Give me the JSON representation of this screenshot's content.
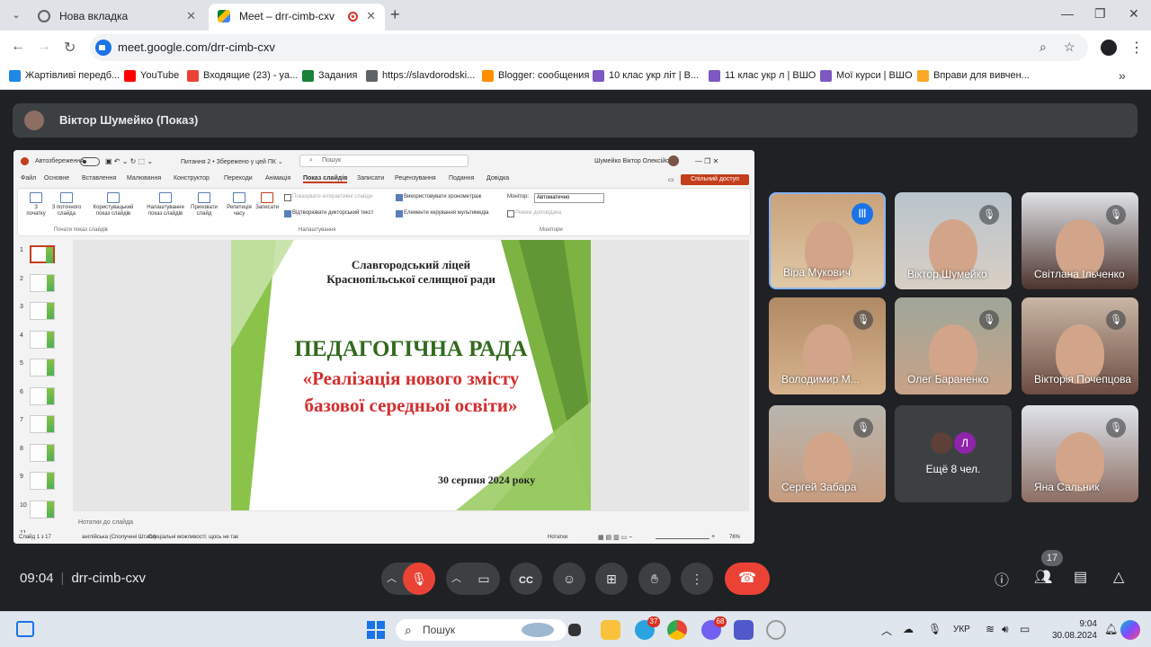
{
  "browser": {
    "tabs": [
      {
        "title": "Нова вкладка"
      },
      {
        "title": "Meet – drr-cimb-cxv"
      }
    ],
    "url": "meet.google.com/drr-cimb-cxv",
    "bookmarks": [
      {
        "label": "Жартівливі передб...",
        "color": "#1e88e5"
      },
      {
        "label": "YouTube",
        "color": "#ff0000"
      },
      {
        "label": "Входящие (23) - ya...",
        "color": "#ea4335"
      },
      {
        "label": "Задания",
        "color": "#188038"
      },
      {
        "label": "https://slavdorodski...",
        "color": "#5f6368"
      },
      {
        "label": "Blogger: сообщения",
        "color": "#ff8f00"
      },
      {
        "label": "10 клас укр літ | В...",
        "color": "#7e57c2"
      },
      {
        "label": "11 клас укр л | ВШО",
        "color": "#7e57c2"
      },
      {
        "label": "Мої курси | ВШО",
        "color": "#7e57c2"
      },
      {
        "label": "Вправи для вивчен...",
        "color": "#f9a825"
      }
    ]
  },
  "meet": {
    "presenter_label": "Віктор Шумейко (Показ)",
    "time": "09:04",
    "meeting_code": "drr-cimb-cxv",
    "participant_count": "17",
    "participants": [
      {
        "name": "Віра Мукович",
        "speaking": true
      },
      {
        "name": "Віктор Шумейко",
        "speaking": false
      },
      {
        "name": "Світлана Ільченко",
        "speaking": false
      },
      {
        "name": "Володимир М...",
        "speaking": false
      },
      {
        "name": "Олег Бараненко",
        "speaking": false
      },
      {
        "name": "Вікторія Почепцова",
        "speaking": false
      },
      {
        "name": "Сергей Забара",
        "speaking": false
      },
      {
        "name": "Яна Сальник",
        "speaking": false
      }
    ],
    "more_tile": {
      "label": "Ещё 8 чел.",
      "initial": "Л"
    }
  },
  "ppt": {
    "autosave": "Автозбереження",
    "doc_title": "Питання 2 • Збережено у цей ПК ⌄",
    "search_placeholder": "Пошук",
    "user": "Шумейко Віктор Олексійович",
    "tabs": [
      "Файл",
      "Основне",
      "Вставлення",
      "Малювання",
      "Конструктор",
      "Переходи",
      "Анімація",
      "Показ слайдів",
      "Записати",
      "Рецензування",
      "Подання",
      "Довідка"
    ],
    "share": "Спільний доступ",
    "ribbon": {
      "btn_from_start": "З\nпочатку",
      "btn_from_current": "З поточного\nслайда",
      "btn_custom": "Користувацький\nпоказ слайдів",
      "btn_setup": "Налаштування\nпоказ слайдів",
      "btn_hide": "Приховати\nслайд",
      "btn_rehearse": "Репетиція\nчасу",
      "btn_record": "Записати",
      "opt_narration": "Показувати інтерактивні слайди",
      "opt_timings": "Використовувати хронометраж",
      "opt_play_narr": "Відтворювати дикторський текст",
      "opt_media": "Елементи керування мультимедіа",
      "monitor_label": "Монітор:",
      "monitor_value": "Автоматично",
      "presenter_view": "Режим доповідача",
      "group_start": "Почати показ слайдів",
      "group_setup": "Налаштування",
      "group_monitors": "Монітори"
    },
    "slide": {
      "school_line1": "Славгородський ліцей",
      "school_line2": "Краснопільської селищної ради",
      "title": "ПЕДАГОГІЧНА РАДА",
      "subtitle_line1": "«Реалізація нового змісту",
      "subtitle_line2": "базової середньої освіти»",
      "date": "30 серпня 2024 року"
    },
    "notes_placeholder": "Нотатки до слайда",
    "status_slide": "Слайд 1 з 17",
    "status_lang": "англійська (Сполучені Штати)",
    "status_access": "Спеціальні можливості: щось не так",
    "status_notes": "Нотатки",
    "status_zoom": "76%",
    "thumb_numbers": [
      "1",
      "2",
      "3",
      "4",
      "5",
      "6",
      "7",
      "8",
      "9",
      "10",
      "11"
    ]
  },
  "taskbar": {
    "search_placeholder": "Пошук",
    "telegram_badge": "37",
    "viber_badge": "68",
    "lang": "УКР",
    "clock_time": "9:04",
    "clock_date": "30.08.2024"
  }
}
